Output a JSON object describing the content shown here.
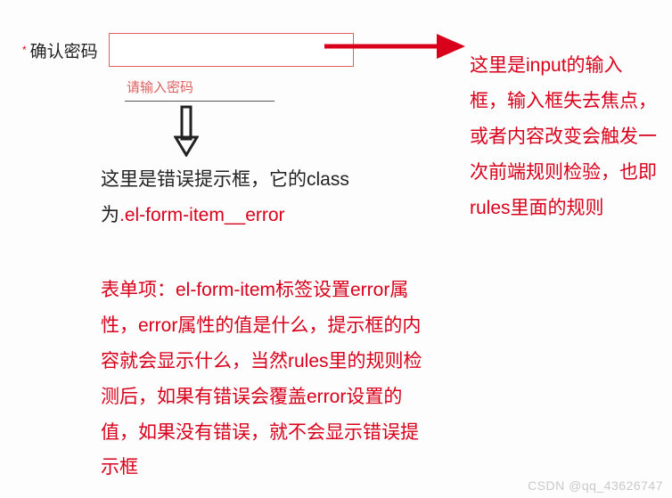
{
  "form": {
    "required_star": "*",
    "label": "确认密码",
    "value": "",
    "error_msg": "请输入密码"
  },
  "annotations": {
    "error_tip_text_pre": "这里是错误提示框，它的class为",
    "error_tip_classname": ".el-form-item__error",
    "form_item_explain": "表单项：el-form-item标签设置error属性，error属性的值是什么，提示框的内容就会显示什么，当然rules里的规则检测后，如果有错误会覆盖error设置的值，如果没有错误，就不会显示错误提示框",
    "input_explain": "这里是input的输入框，输入框失去焦点，或者内容改变会触发一次前端规则检验，也即rules里面的规则"
  },
  "watermark": "CSDN @qq_43626747"
}
